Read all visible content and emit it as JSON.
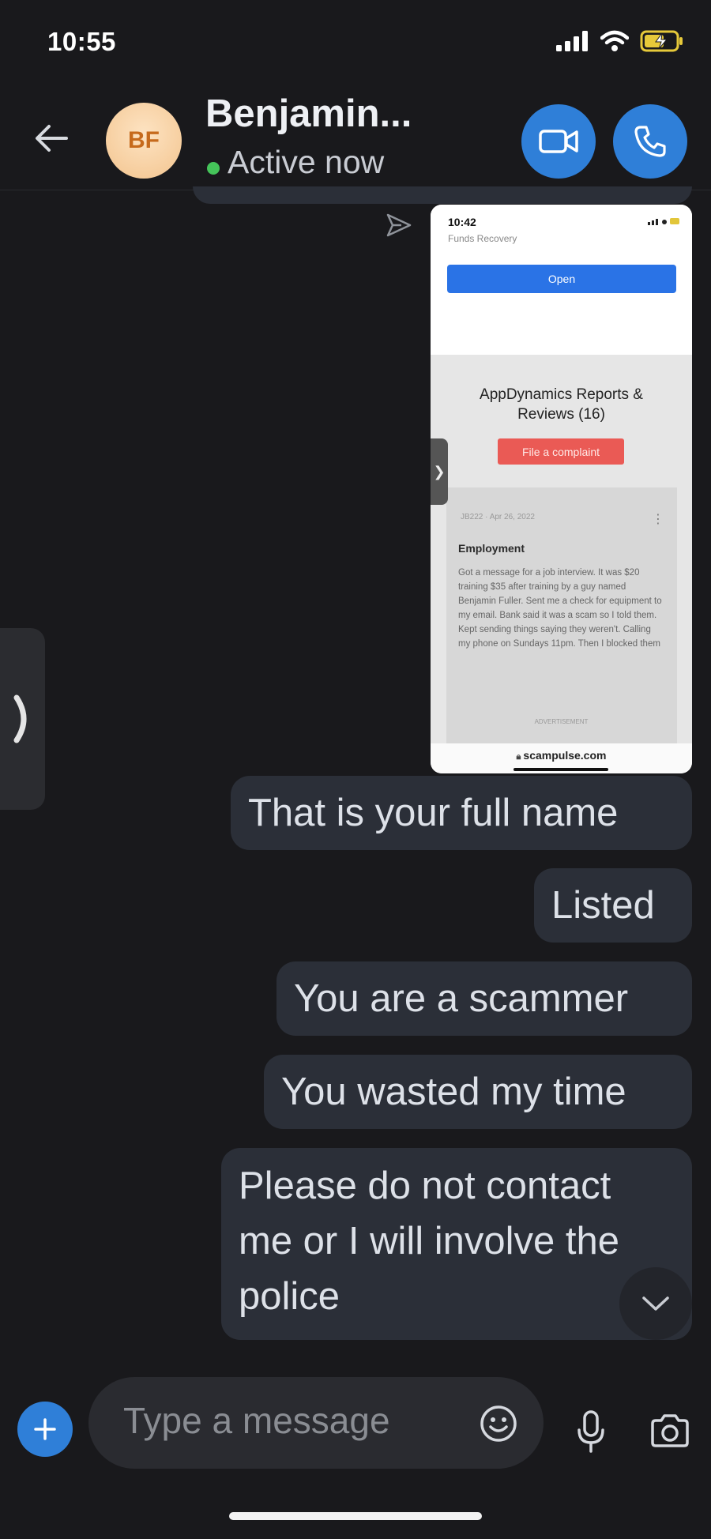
{
  "status_bar": {
    "time": "10:55"
  },
  "header": {
    "avatar_initials": "BF",
    "name": "Benjamin...",
    "status": "Active now"
  },
  "shared_image": {
    "time": "10:42",
    "top_label": "Funds Recovery",
    "open_button": "Open",
    "title": "AppDynamics Reports & Reviews (16)",
    "complaint_button": "File a complaint",
    "review_meta": "JB222 · Apr 26, 2022",
    "review_title": "Employment",
    "review_body": "Got a message for a job interview. It was $20 training $35 after training by a guy named Benjamin Fuller. Sent me a check for equipment to my email. Bank said it was a scam so I told them. Kept sending things saying they weren't. Calling my phone on Sundays 11pm. Then I blocked them",
    "ad_label": "ADVERTISEMENT",
    "url": "scampulse.com"
  },
  "messages": [
    {
      "text": "That is your full name"
    },
    {
      "text": "Listed"
    },
    {
      "text": "You are a scammer"
    },
    {
      "text": "You wasted my time"
    },
    {
      "text": "Please do not contact me or I will involve the police"
    }
  ],
  "composer": {
    "placeholder": "Type a message"
  },
  "colors": {
    "accent": "#2f7fd8",
    "bubble": "#2b2f38",
    "background": "#19191c",
    "online": "#45c45a"
  }
}
